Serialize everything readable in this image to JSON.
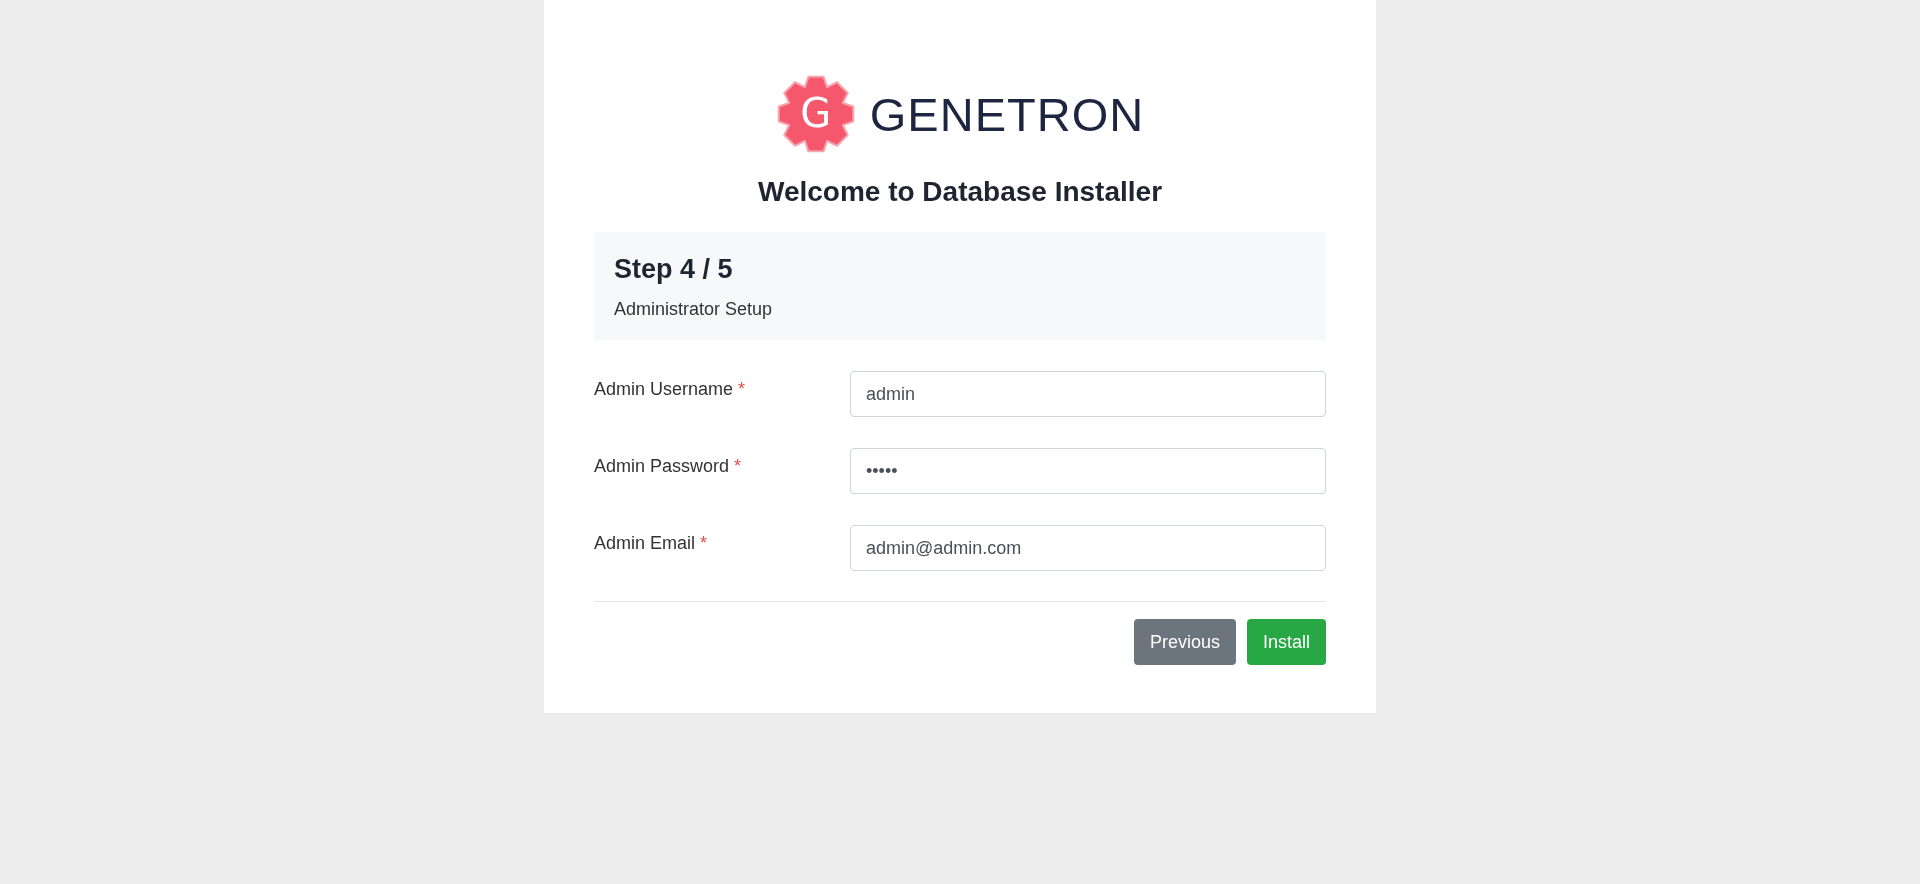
{
  "logo": {
    "mark": "G",
    "name": "GENETRON"
  },
  "title": "Welcome to Database Installer",
  "step": {
    "heading": "Step 4 / 5",
    "subtitle": "Administrator Setup"
  },
  "fields": [
    {
      "label": "Admin Username",
      "required_mark": "*",
      "value": "admin"
    },
    {
      "label": "Admin Password",
      "required_mark": "*",
      "value": "•••••"
    },
    {
      "label": "Admin Email",
      "required_mark": "*",
      "value": "admin@admin.com"
    }
  ],
  "buttons": [
    {
      "label": "Previous",
      "kind": "secondary"
    },
    {
      "label": "Install",
      "kind": "primary"
    }
  ]
}
